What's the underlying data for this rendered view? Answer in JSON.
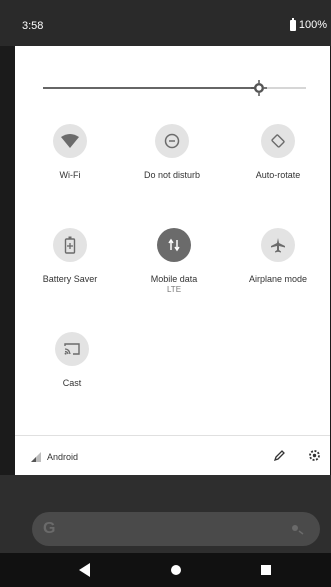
{
  "status": {
    "time": "3:58",
    "battery": "100%"
  },
  "brightness": {
    "level": 0.82
  },
  "tiles": [
    {
      "label": "Wi-Fi",
      "sub": "",
      "icon": "wifi-icon",
      "active": false
    },
    {
      "label": "Do not disturb",
      "sub": "",
      "icon": "do-not-disturb-icon",
      "active": false
    },
    {
      "label": "Auto-rotate",
      "sub": "",
      "icon": "auto-rotate-icon",
      "active": false
    },
    {
      "label": "Battery Saver",
      "sub": "",
      "icon": "battery-saver-icon",
      "active": false
    },
    {
      "label": "Mobile data",
      "sub": "LTE",
      "icon": "mobile-data-icon",
      "active": true
    },
    {
      "label": "Airplane mode",
      "sub": "",
      "icon": "airplane-icon",
      "active": false
    },
    {
      "label": "Cast",
      "sub": "",
      "icon": "cast-icon",
      "active": false
    }
  ],
  "footer": {
    "carrier": "Android"
  },
  "search": {
    "logo": "G"
  }
}
